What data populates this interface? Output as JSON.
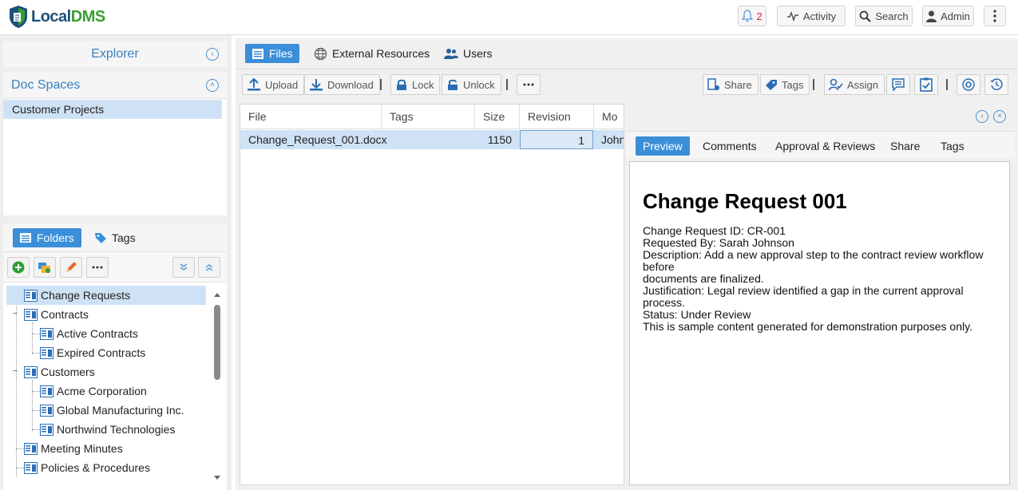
{
  "app": {
    "logo_part1": "Local",
    "logo_part2": "DMS"
  },
  "topbar": {
    "notifications_count": "2",
    "activity_label": "Activity",
    "search_label": "Search",
    "admin_label": "Admin"
  },
  "explorer": {
    "title": "Explorer",
    "doc_spaces_title": "Doc Spaces",
    "doc_spaces": [
      "Customer Projects"
    ]
  },
  "folders_panel": {
    "tabs": [
      "Folders",
      "Tags"
    ],
    "tree": [
      {
        "label": "Change Requests",
        "level": 0,
        "selected": true
      },
      {
        "label": "Contracts",
        "level": 0,
        "expanded": true
      },
      {
        "label": "Active Contracts",
        "level": 1
      },
      {
        "label": "Expired Contracts",
        "level": 1
      },
      {
        "label": "Customers",
        "level": 0,
        "expanded": true
      },
      {
        "label": "Acme Corporation",
        "level": 1
      },
      {
        "label": "Global Manufacturing Inc.",
        "level": 1
      },
      {
        "label": "Northwind Technologies",
        "level": 1
      },
      {
        "label": "Meeting Minutes",
        "level": 0
      },
      {
        "label": "Policies & Procedures",
        "level": 0
      }
    ]
  },
  "main_tabs": [
    "Files",
    "External Resources",
    "Users"
  ],
  "actions": {
    "upload": "Upload",
    "download": "Download",
    "lock": "Lock",
    "unlock": "Unlock",
    "share": "Share",
    "tags": "Tags",
    "assign": "Assign"
  },
  "files_grid": {
    "columns": [
      "File",
      "Tags",
      "Size",
      "Revision",
      "Mo"
    ],
    "rows": [
      {
        "file": "Change_Request_001.docx",
        "tags": "",
        "size": "1150",
        "revision": "1",
        "modified_by": "John"
      }
    ]
  },
  "preview": {
    "tabs": [
      "Preview",
      "Comments",
      "Approval & Reviews",
      "Share",
      "Tags"
    ],
    "doc_title": "Change Request 001",
    "doc_lines": [
      "Change Request ID: CR-001",
      "Requested By: Sarah Johnson",
      "Description: Add a new approval step to the contract review workflow before",
      "documents are finalized.",
      "Justification: Legal review identified a gap in the current approval process.",
      "Status: Under Review",
      "This is sample content generated for demonstration purposes only."
    ]
  },
  "colors": {
    "accent": "#3a8fd8",
    "selection": "#cfe2f5",
    "logo_blue": "#1d4f7a",
    "logo_green": "#3a9d2e",
    "notification": "#dd2233"
  }
}
